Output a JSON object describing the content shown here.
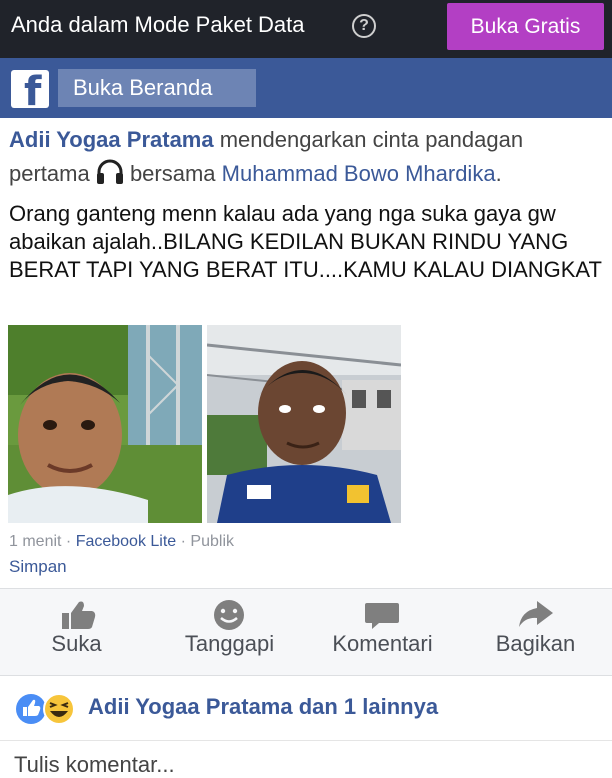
{
  "top_bar": {
    "message": "Anda dalam Mode Paket Data",
    "help_symbol": "?",
    "open_free_label": "Buka Gratis",
    "accent_color": "#b33fc4"
  },
  "fb_bar": {
    "logo_letter": "f",
    "home_label": "Buka Beranda",
    "brand_color": "#3b5998"
  },
  "post": {
    "author": "Adii Yogaa Pratama",
    "activity_pre": " mendengarkan cinta pandagan pertama ",
    "activity_icon": "headphones-icon",
    "activity_with": " bersama ",
    "tagged": "Muhammad Bowo Mhardika",
    "activity_end": ".",
    "text": "Orang ganteng menn kalau ada yang nga suka gaya gw abaikan ajalah..BILANG KEDILAN BUKAN RINDU YANG BERAT TAPI YANG BERAT ITU....KAMU KALAU DIANGKAT",
    "time": "1 menit",
    "source": "Facebook Lite",
    "privacy": "Publik",
    "separator": " · ",
    "save_label": "Simpan"
  },
  "actions": [
    {
      "label": "Suka",
      "icon": "thumbs-up-icon"
    },
    {
      "label": "Tanggapi",
      "icon": "smiley-icon"
    },
    {
      "label": "Komentari",
      "icon": "comment-icon"
    },
    {
      "label": "Bagikan",
      "icon": "share-icon"
    }
  ],
  "reactions": {
    "icons": [
      "like-reaction-icon",
      "haha-reaction-icon"
    ],
    "text": "Adii Yogaa Pratama dan 1 lainnya"
  },
  "comment_placeholder": "Tulis komentar..."
}
